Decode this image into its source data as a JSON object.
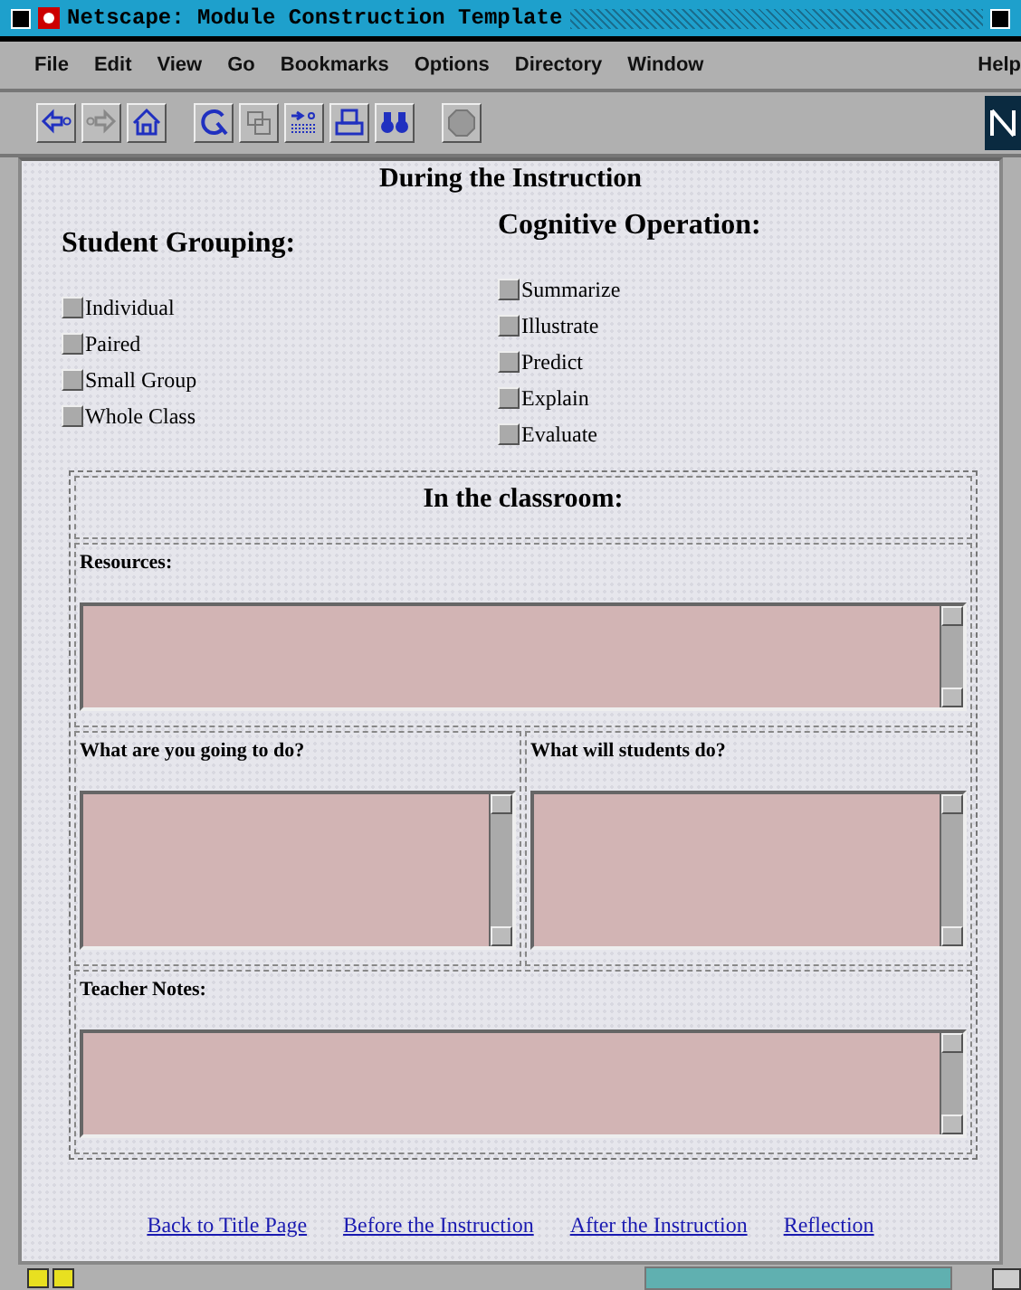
{
  "window": {
    "title": "Netscape: Module Construction Template"
  },
  "menu": [
    "File",
    "Edit",
    "View",
    "Go",
    "Bookmarks",
    "Options",
    "Directory",
    "Window",
    "Help"
  ],
  "page": {
    "heading": "During the Instruction",
    "groups": [
      {
        "title": "Student Grouping:",
        "options": [
          {
            "label": "Individual",
            "checked": false
          },
          {
            "label": "Paired",
            "checked": false
          },
          {
            "label": "Small Group",
            "checked": false
          },
          {
            "label": "Whole Class",
            "checked": false
          }
        ]
      },
      {
        "title": "Cognitive Operation:",
        "options": [
          {
            "label": "Summarize",
            "checked": false
          },
          {
            "label": "Illustrate",
            "checked": false
          },
          {
            "label": "Predict",
            "checked": false
          },
          {
            "label": "Explain",
            "checked": false
          },
          {
            "label": "Evaluate",
            "checked": false
          }
        ]
      }
    ],
    "classroom": {
      "title": "In the classroom:",
      "rows": [
        [
          {
            "label": "Resources:"
          }
        ],
        [
          {
            "label": "What are you going to do?"
          },
          {
            "label": "What will students do?"
          }
        ],
        [
          {
            "label": "Teacher Notes:"
          }
        ]
      ]
    },
    "links": [
      "Back to Title Page",
      "Before the Instruction",
      "After the Instruction",
      "Reflection"
    ]
  }
}
